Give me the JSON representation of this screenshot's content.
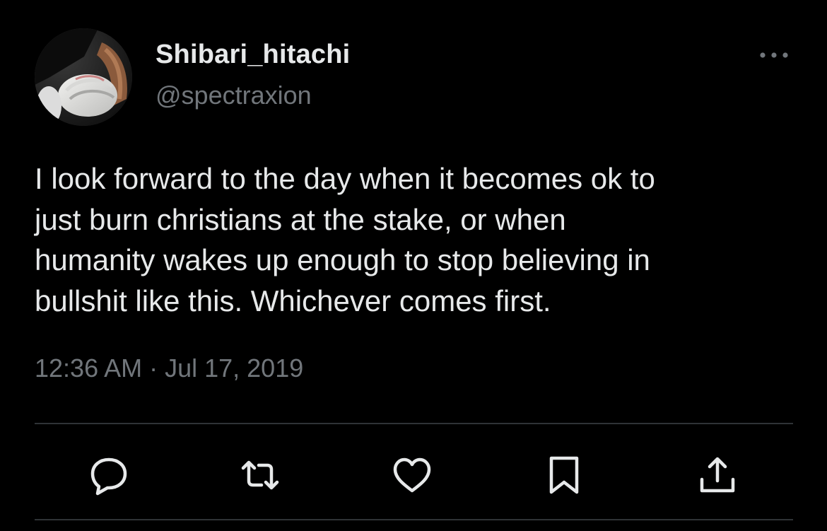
{
  "tweet": {
    "display_name": "Shibari_hitachi",
    "handle": "@spectraxion",
    "text": "I look forward to the day when it becomes ok to\njust burn christians at the stake, or when\nhumanity wakes up enough to stop believing in\nbullshit like this. Whichever comes first.",
    "timestamp": "12:36 AM · Jul 17, 2019"
  },
  "icons": {
    "more": "more-horizontal-icon",
    "reply": "reply-icon",
    "retweet": "retweet-icon",
    "like": "heart-icon",
    "bookmark": "bookmark-icon",
    "share": "share-icon"
  },
  "colors": {
    "background": "#000000",
    "primary_text": "#e7e9ea",
    "secondary_text": "#71767b",
    "divider": "#2f3336",
    "icon": "#e7e9ea"
  }
}
